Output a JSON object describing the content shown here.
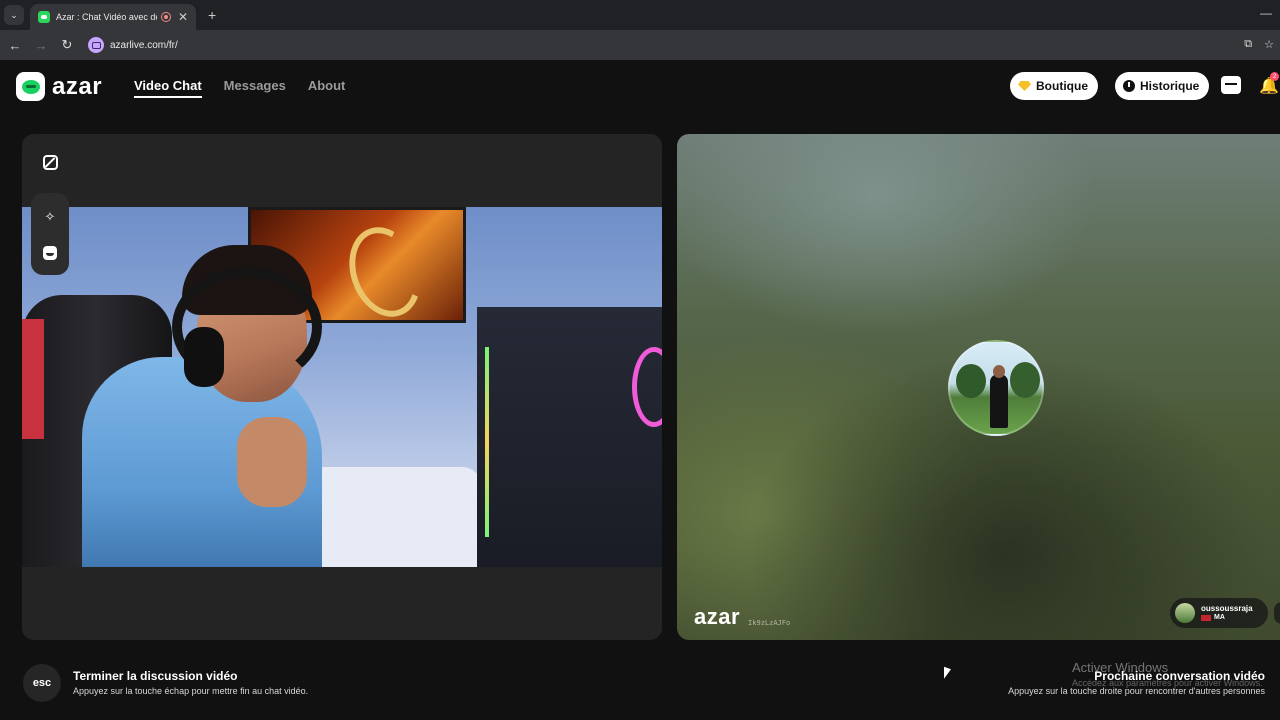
{
  "browser": {
    "tab_title": "Azar : Chat Vidéo avec de n",
    "tab_close": "✕",
    "new_tab": "+",
    "tab_list": "⌄",
    "url": "azarlive.com/fr/",
    "back": "←",
    "forward": "→",
    "reload": "↻",
    "install": "⧉",
    "bookmark": "☆",
    "minimize": "—"
  },
  "header": {
    "logo_text": "azar",
    "nav": [
      {
        "label": "Video Chat",
        "active": true
      },
      {
        "label": "Messages",
        "active": false
      },
      {
        "label": "About",
        "active": false
      }
    ],
    "boutique_label": "Boutique",
    "historique_label": "Historique",
    "notification_count": "2",
    "bell": "🔔"
  },
  "left_panel": {
    "tools": {
      "magic_wand": "✧"
    }
  },
  "right_panel": {
    "watermark_logo": "azar",
    "watermark_id": "Ik9zLzAJFo",
    "partner": {
      "username": "oussoussraja",
      "country": "MA"
    }
  },
  "footer": {
    "esc_key": "esc",
    "end_title": "Terminer la discussion vidéo",
    "end_sub": "Appuyez sur la touche échap pour mettre fin au chat vidéo.",
    "next_title": "Prochaine conversation vidéo",
    "next_sub": "Appuyez sur la touche droite pour rencontrer d'autres personnes",
    "windows_activate": "Activer Windows",
    "windows_activate_sub": "Accédez aux paramètres pour activer Windows."
  },
  "colors": {
    "brand_green": "#19d160",
    "background": "#111111",
    "panel": "#242424",
    "badge_red": "#ff4d6a",
    "gem_yellow": "#f6c026"
  }
}
